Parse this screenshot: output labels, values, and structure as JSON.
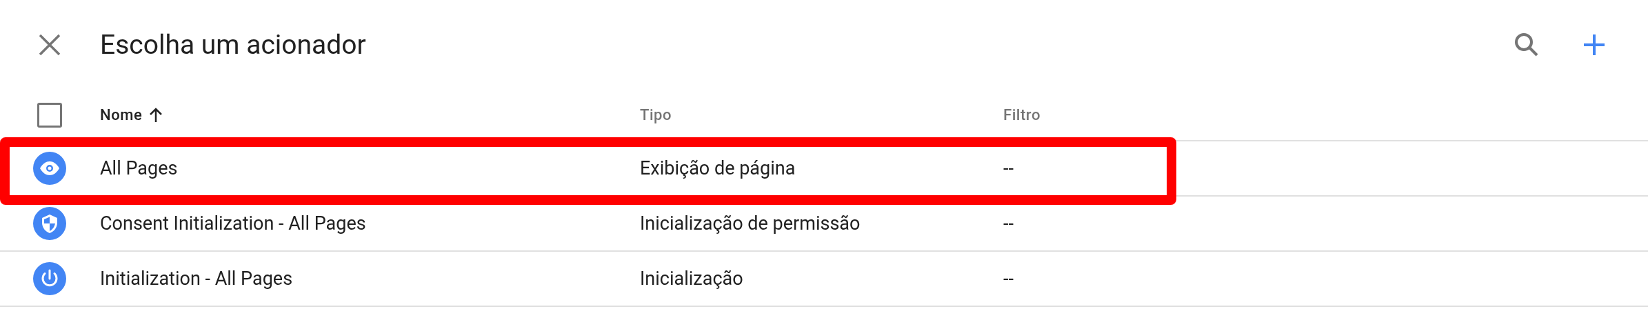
{
  "dialog": {
    "title": "Escolha um acionador"
  },
  "table": {
    "columns": [
      {
        "label": "Nome",
        "sorted": true
      },
      {
        "label": "Tipo",
        "sorted": false
      },
      {
        "label": "Filtro",
        "sorted": false
      }
    ],
    "all_checked": false,
    "rows": [
      {
        "kind": "eye",
        "name": "All Pages",
        "type": "Exibição de página",
        "filter": "--",
        "highlighted": true
      },
      {
        "kind": "shield",
        "name": "Consent Initialization - All Pages",
        "type": "Inicialização de permissão",
        "filter": "--",
        "highlighted": false
      },
      {
        "kind": "power",
        "name": "Initialization - All Pages",
        "type": "Inicialização",
        "filter": "--",
        "highlighted": false
      }
    ]
  }
}
